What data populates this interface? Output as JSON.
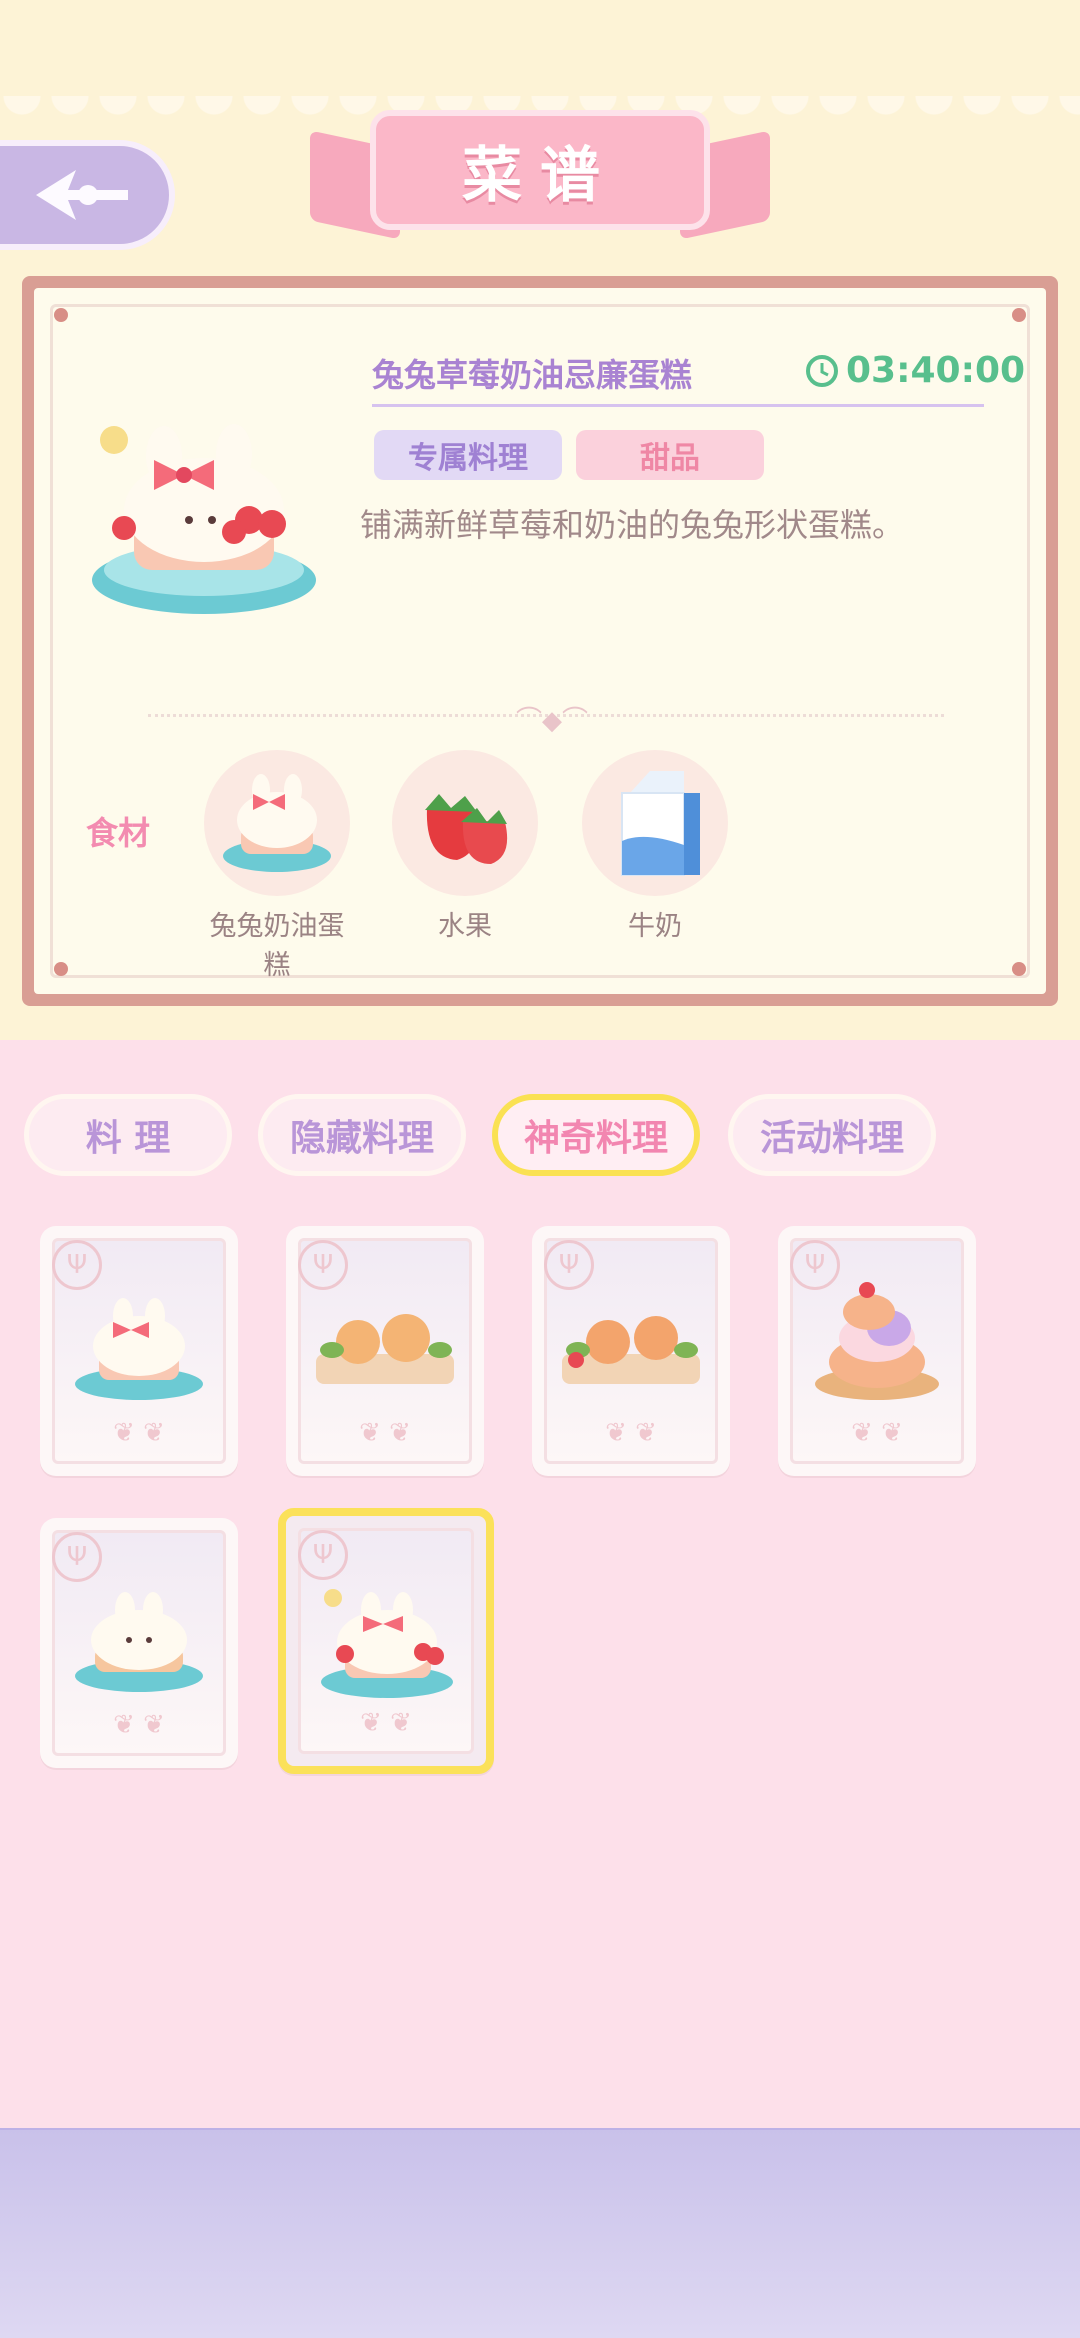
{
  "header": {
    "title": "菜谱"
  },
  "detail": {
    "dish_name": "兔兔草莓奶油忌廉蛋糕",
    "timer": "03:40:00",
    "tags": [
      "专属料理",
      "甜品"
    ],
    "description": "铺满新鲜草莓和奶油的兔兔形状蛋糕。",
    "ingredients_label": "食材",
    "ingredients": [
      {
        "name": "兔兔奶油蛋糕",
        "icon": "bunny-cake-icon"
      },
      {
        "name": "水果",
        "icon": "strawberry-icon"
      },
      {
        "name": "牛奶",
        "icon": "milk-carton-icon"
      }
    ]
  },
  "tabs": [
    {
      "label": "料 理",
      "active": false
    },
    {
      "label": "隐藏料理",
      "active": false
    },
    {
      "label": "神奇料理",
      "active": true
    },
    {
      "label": "活动料理",
      "active": false
    }
  ],
  "recipes": [
    {
      "icon": "bunny-cake-icon",
      "selected": false
    },
    {
      "icon": "bread-platter-icon",
      "selected": false
    },
    {
      "icon": "bread-platter-icon",
      "selected": false
    },
    {
      "icon": "cream-puff-icon",
      "selected": false
    },
    {
      "icon": "bunny-pancake-icon",
      "selected": false
    },
    {
      "icon": "bunny-strawberry-cake-icon",
      "selected": true
    }
  ],
  "colors": {
    "accent_pink": "#f286b0",
    "accent_purple": "#a983d2",
    "timer_green": "#58bf8d",
    "highlight_yellow": "#fae153"
  }
}
